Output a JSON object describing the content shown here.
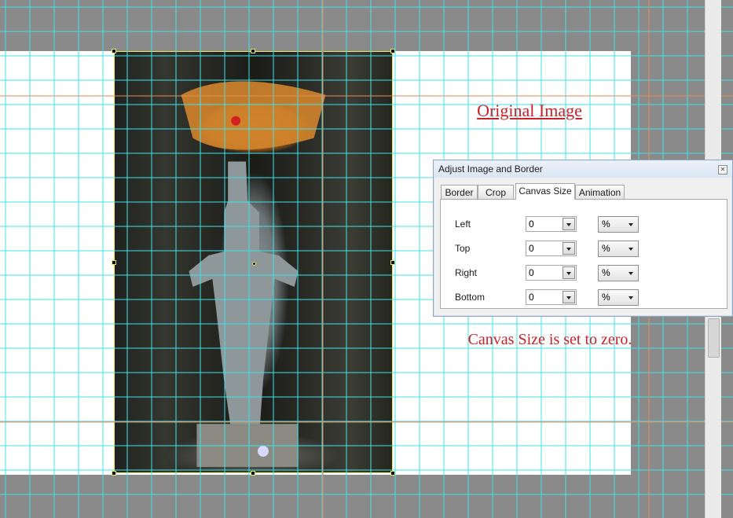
{
  "canvas": {
    "title": "Original Image",
    "note": "Canvas Size is set to zero."
  },
  "panel": {
    "title": "Adjust Image and Border",
    "close_icon": "close-icon",
    "tabs": [
      {
        "label": "Border"
      },
      {
        "label": "Crop"
      },
      {
        "label": "Canvas Size",
        "active": true
      },
      {
        "label": "Animation"
      }
    ],
    "fields": [
      {
        "label": "Left",
        "value": "0",
        "unit": "%"
      },
      {
        "label": "Top",
        "value": "0",
        "unit": "%"
      },
      {
        "label": "Right",
        "value": "0",
        "unit": "%"
      },
      {
        "label": "Bottom",
        "value": "0",
        "unit": "%"
      }
    ]
  },
  "colors": {
    "grid_line": "#3fe3e8",
    "guide_line": "#e88a55",
    "annotation_text": "#c8222a",
    "selection_border": "#e8e86a"
  }
}
